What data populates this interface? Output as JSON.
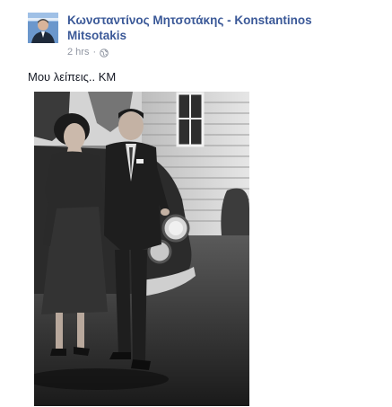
{
  "post": {
    "author_name": "Κωνσταντίνος Μητσοτάκης - Konstantinos Mitsotakis",
    "timestamp": "2 hrs",
    "separator": "·",
    "privacy_icon": "globe-icon",
    "message": "Μου λείπεις.. ΚΜ",
    "photo": "black-and-white-couple-photo"
  },
  "colors": {
    "author_link": "#3b5998",
    "meta_text": "#9197a3",
    "body_text": "#141823",
    "avatar_bg": "#5d8bc2"
  }
}
